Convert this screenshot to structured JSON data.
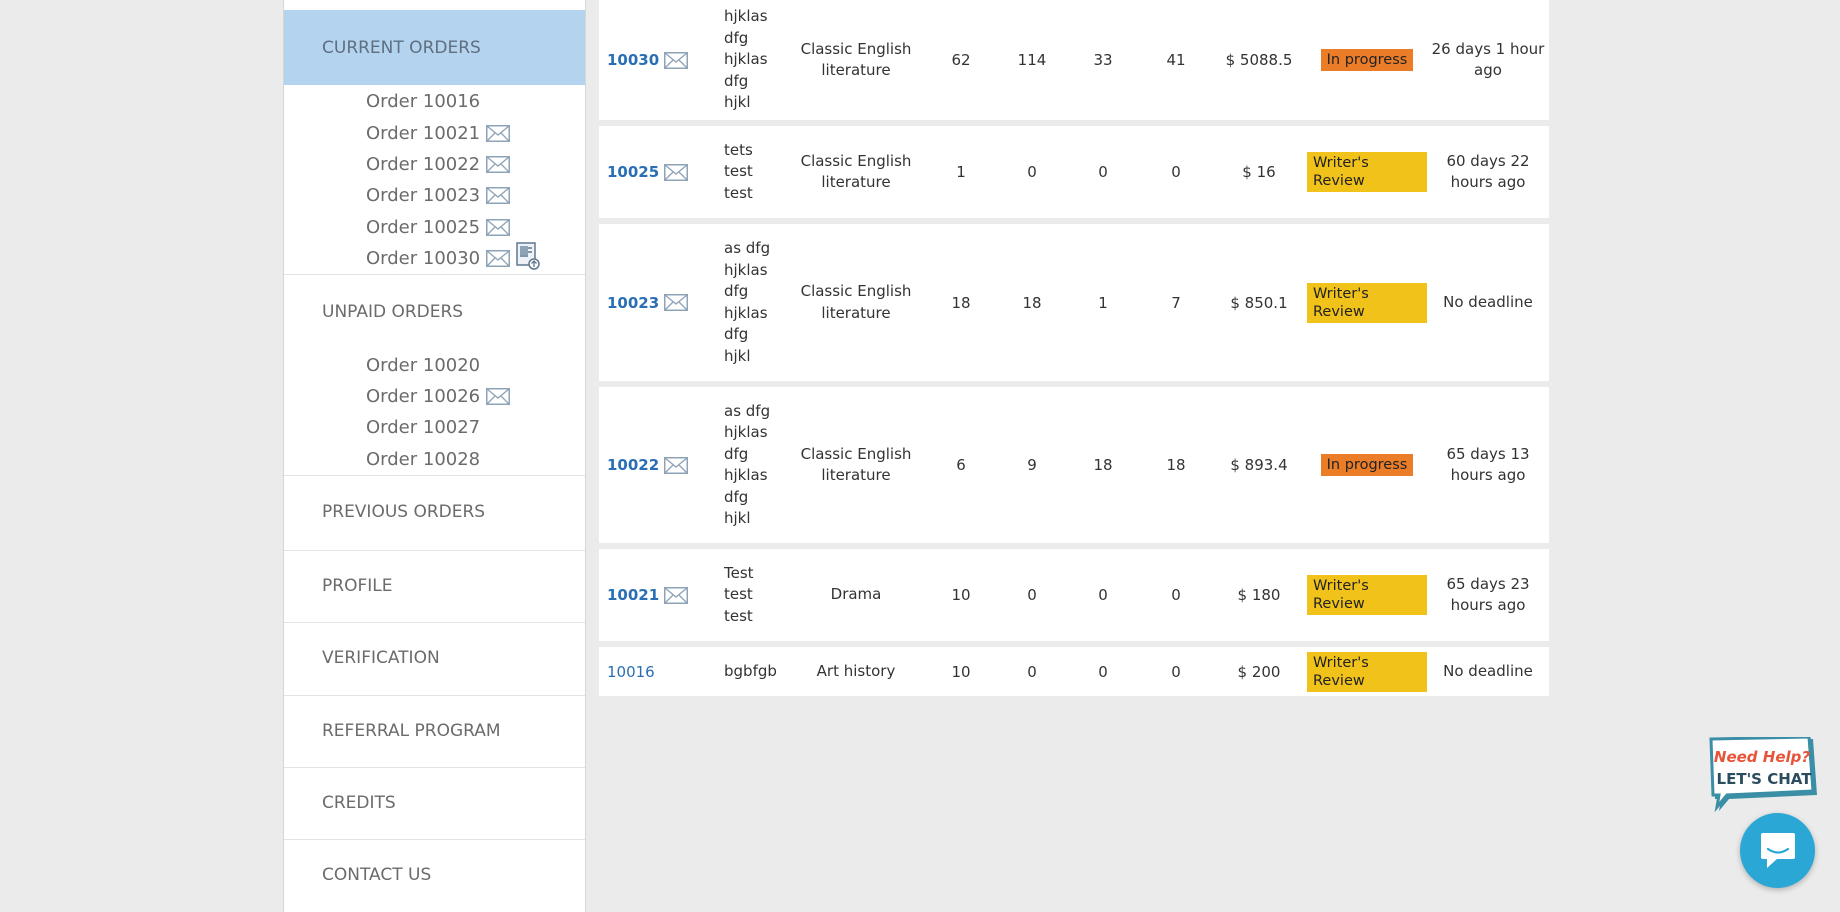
{
  "sidebar": {
    "current_orders": {
      "label": "CURRENT ORDERS",
      "items": [
        {
          "label": "Order 10016",
          "mail": false,
          "upload": false
        },
        {
          "label": "Order 10021",
          "mail": true,
          "upload": false
        },
        {
          "label": "Order 10022",
          "mail": true,
          "upload": false
        },
        {
          "label": "Order 10023",
          "mail": true,
          "upload": false
        },
        {
          "label": "Order 10025",
          "mail": true,
          "upload": false
        },
        {
          "label": "Order 10030",
          "mail": true,
          "upload": true
        }
      ]
    },
    "unpaid_orders": {
      "label": "UNPAID ORDERS",
      "items": [
        {
          "label": "Order 10020",
          "mail": false
        },
        {
          "label": "Order 10026",
          "mail": true
        },
        {
          "label": "Order 10027",
          "mail": false
        },
        {
          "label": "Order 10028",
          "mail": false
        }
      ]
    },
    "previous_orders": "PREVIOUS ORDERS",
    "profile": "PROFILE",
    "verification": "VERIFICATION",
    "referral_program": "REFERRAL PROGRAM",
    "credits": "CREDITS",
    "contact_us": "CONTACT US"
  },
  "orders": [
    {
      "id": "10030",
      "mail": true,
      "topic": "hjklas\ndfg\nhjklas\ndfg\nhjkl",
      "subject": "Classic English literature",
      "n1": "62",
      "n2": "114",
      "n3": "33",
      "n4": "41",
      "price": "$ 5088.5",
      "status": "In progress",
      "status_type": "progress",
      "deadline": "26 days 1 hour ago"
    },
    {
      "id": "10025",
      "mail": true,
      "topic": "tets\ntest\ntest",
      "subject": "Classic English literature",
      "n1": "1",
      "n2": "0",
      "n3": "0",
      "n4": "0",
      "price": "$ 16",
      "status": "Writer's Review",
      "status_type": "review",
      "deadline": "60 days 22 hours ago"
    },
    {
      "id": "10023",
      "mail": true,
      "topic": "as dfg\nhjklas\ndfg\nhjklas\ndfg\nhjkl",
      "subject": "Classic English literature",
      "n1": "18",
      "n2": "18",
      "n3": "1",
      "n4": "7",
      "price": "$ 850.1",
      "status": "Writer's Review",
      "status_type": "review",
      "deadline": "No deadline"
    },
    {
      "id": "10022",
      "mail": true,
      "topic": "as dfg\nhjklas\ndfg\nhjklas\ndfg\nhjkl",
      "subject": "Classic English literature",
      "n1": "6",
      "n2": "9",
      "n3": "18",
      "n4": "18",
      "price": "$ 893.4",
      "status": "In progress",
      "status_type": "progress",
      "deadline": "65 days 13 hours ago"
    },
    {
      "id": "10021",
      "mail": true,
      "topic": "Test\ntest\ntest",
      "subject": "Drama",
      "n1": "10",
      "n2": "0",
      "n3": "0",
      "n4": "0",
      "price": "$ 180",
      "status": "Writer's Review",
      "status_type": "review",
      "deadline": "65 days 23 hours ago"
    },
    {
      "id": "10016",
      "mail": false,
      "topic": "bgbfgb",
      "subject": "Art history",
      "n1": "10",
      "n2": "0",
      "n3": "0",
      "n4": "0",
      "price": "$ 200",
      "status": "Writer's Review",
      "status_type": "review",
      "deadline": "No deadline"
    }
  ],
  "chat": {
    "help_line1": "Need Help?",
    "help_line2": "LET'S CHAT"
  },
  "colors": {
    "accent_active": "#b3d3ef",
    "link": "#2a6fb5",
    "status_progress": "#ec7d28",
    "status_review": "#f1c31a",
    "chat": "#2aa7d4"
  }
}
